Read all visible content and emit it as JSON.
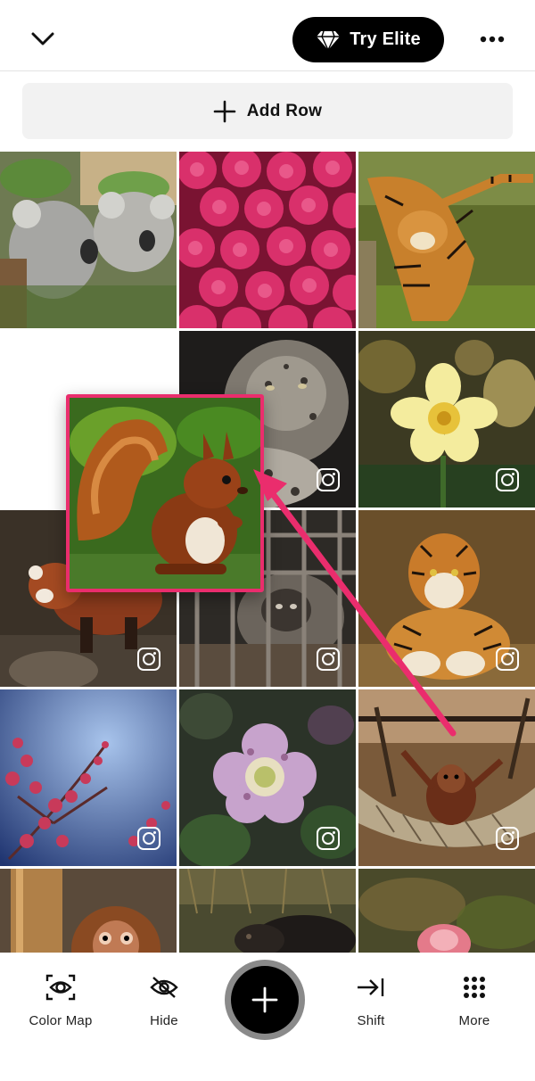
{
  "header": {
    "back_icon": "chevron-down-icon",
    "elite_label": "Try Elite",
    "elite_icon": "diamond-icon",
    "more_icon": "more-horizontal-icon"
  },
  "add_row": {
    "label": "Add Row",
    "icon": "plus-icon"
  },
  "grid": {
    "tiles": [
      {
        "subject": "koalas",
        "instagram": false
      },
      {
        "subject": "pink dahlias",
        "instagram": false
      },
      {
        "subject": "tiger stretching",
        "instagram": false
      },
      {
        "subject": "empty slot",
        "instagram": false
      },
      {
        "subject": "snow leopard",
        "instagram": true
      },
      {
        "subject": "daffodils",
        "instagram": true
      },
      {
        "subject": "red panda",
        "instagram": true
      },
      {
        "subject": "monkey behind bars",
        "instagram": true
      },
      {
        "subject": "tiger lying",
        "instagram": true
      },
      {
        "subject": "pink blossom branch",
        "instagram": true
      },
      {
        "subject": "pink hellebore flower",
        "instagram": true
      },
      {
        "subject": "orangutan in hammock",
        "instagram": true
      },
      {
        "subject": "baby orangutan",
        "instagram": false
      },
      {
        "subject": "small mammal in grass",
        "instagram": false
      },
      {
        "subject": "pink flower bokeh",
        "instagram": false
      }
    ],
    "dragged_tile": {
      "subject": "red squirrel"
    },
    "drag_arrow_color": "#ea2d6d"
  },
  "toolbar": {
    "items": [
      {
        "label": "Color Map",
        "icon": "eye-scan-icon"
      },
      {
        "label": "Hide",
        "icon": "eye-slash-icon"
      },
      {
        "label": "Shift",
        "icon": "arrow-to-right-icon"
      },
      {
        "label": "More",
        "icon": "grid-dots-icon"
      }
    ],
    "fab_icon": "plus-icon"
  },
  "colors": {
    "accent": "#ea2d6d",
    "black": "#000000",
    "button_bg": "#f2f2f2"
  }
}
